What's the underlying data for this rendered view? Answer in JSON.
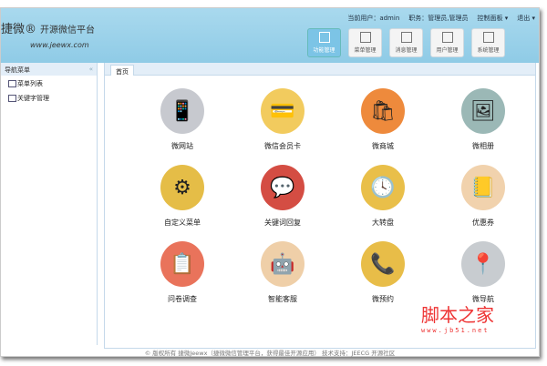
{
  "header": {
    "logo": "捷微®",
    "logo_sub": "开源微信平台",
    "url": "www.jeewx.com",
    "user_label": "当前用户：admin",
    "role_label": "职务：管理员,管理员",
    "control_panel": "控制面板 ▾",
    "logout": "退出 ▾"
  },
  "nav_buttons": [
    {
      "label": "功能管理"
    },
    {
      "label": "菜单管理"
    },
    {
      "label": "消息管理"
    },
    {
      "label": "用户管理"
    },
    {
      "label": "系统管理"
    }
  ],
  "sidebar": {
    "title": "导航菜单",
    "collapse": "«",
    "items": [
      {
        "label": "菜单列表"
      },
      {
        "label": "关键字管理"
      }
    ]
  },
  "tabs": [
    {
      "label": "首页"
    }
  ],
  "features": [
    {
      "label": "微网站",
      "icon": "📱",
      "color": "#c7c9cf"
    },
    {
      "label": "微信会员卡",
      "icon": "💳",
      "color": "#f2cb5e"
    },
    {
      "label": "微商城",
      "icon": "🛍",
      "color": "#ee8a3c"
    },
    {
      "label": "微相册",
      "icon": "🖼",
      "color": "#9bb8b6"
    },
    {
      "label": "自定义菜单",
      "icon": "⚙",
      "color": "#e5bd47"
    },
    {
      "label": "关键词回复",
      "icon": "💬",
      "color": "#d44d43"
    },
    {
      "label": "大转盘",
      "icon": "🕓",
      "color": "#e9bf49"
    },
    {
      "label": "优惠券",
      "icon": "📒",
      "color": "#f1d2ad"
    },
    {
      "label": "问卷调查",
      "icon": "📋",
      "color": "#e9735b"
    },
    {
      "label": "智能客服",
      "icon": "🤖",
      "color": "#efcfa8"
    },
    {
      "label": "微预约",
      "icon": "📞",
      "color": "#e8bd48"
    },
    {
      "label": "微导航",
      "icon": "📍",
      "color": "#c8ccd0"
    }
  ],
  "footer": "© 版权所有 捷微Jeewx（捷微微信管理平台，获得最佳开源应用） 技术支持：JEECG 开源社区",
  "watermark": {
    "text": "脚本之家",
    "url": "www.jb51.net"
  }
}
